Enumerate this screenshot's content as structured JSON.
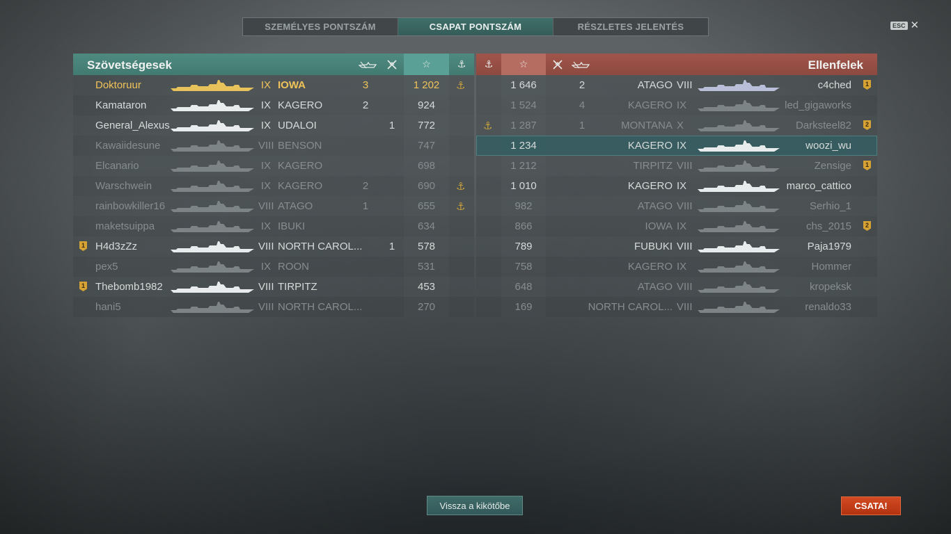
{
  "tabs": [
    {
      "label": "SZEMÉLYES PONTSZÁM",
      "active": false
    },
    {
      "label": "CSAPAT PONTSZÁM",
      "active": true
    },
    {
      "label": "RÉSZLETES JELENTÉS",
      "active": false
    }
  ],
  "esc": {
    "key": "ESC",
    "close": "✕"
  },
  "allies": {
    "title": "Szövetségesek",
    "header_icons": [
      "ship-kill-icon",
      "plane-kill-icon",
      "star-icon",
      "anchor-icon"
    ],
    "rows": [
      {
        "name": "Doktoruur",
        "tier": "IX",
        "ship": "IOWA",
        "kills": "3",
        "planes": "",
        "score": "1 202",
        "anchor": "⚓",
        "badge": "",
        "state": "me"
      },
      {
        "name": "Kamataron",
        "tier": "IX",
        "ship": "KAGERO",
        "kills": "2",
        "planes": "",
        "score": "924",
        "anchor": "",
        "badge": "",
        "state": "alive"
      },
      {
        "name": "General_Alexus",
        "tier": "IX",
        "ship": "UDALOI",
        "kills": "",
        "planes": "1",
        "score": "772",
        "anchor": "",
        "badge": "",
        "state": "alive"
      },
      {
        "name": "Kawaiidesune",
        "tier": "VIII",
        "ship": "BENSON",
        "kills": "",
        "planes": "",
        "score": "747",
        "anchor": "",
        "badge": "",
        "state": "dead"
      },
      {
        "name": "Elcanario",
        "tier": "IX",
        "ship": "KAGERO",
        "kills": "",
        "planes": "",
        "score": "698",
        "anchor": "",
        "badge": "",
        "state": "dead"
      },
      {
        "name": "Warschwein",
        "tier": "IX",
        "ship": "KAGERO",
        "kills": "2",
        "planes": "",
        "score": "690",
        "anchor": "⚓",
        "badge": "",
        "state": "dead"
      },
      {
        "name": "rainbowkiller16",
        "tier": "VIII",
        "ship": "ATAGO",
        "kills": "1",
        "planes": "",
        "score": "655",
        "anchor": "⚓",
        "badge": "",
        "state": "dead"
      },
      {
        "name": "maketsuippa",
        "tier": "IX",
        "ship": "IBUKI",
        "kills": "",
        "planes": "",
        "score": "634",
        "anchor": "",
        "badge": "",
        "state": "dead"
      },
      {
        "name": "H4d3zZz",
        "tier": "VIII",
        "ship": "NORTH CAROL...",
        "kills": "",
        "planes": "1",
        "score": "578",
        "anchor": "",
        "badge": "1",
        "state": "alive"
      },
      {
        "name": "pex5",
        "tier": "IX",
        "ship": "ROON",
        "kills": "",
        "planes": "",
        "score": "531",
        "anchor": "",
        "badge": "",
        "state": "dead"
      },
      {
        "name": "Thebomb1982",
        "tier": "VIII",
        "ship": "TIRPITZ",
        "kills": "",
        "planes": "",
        "score": "453",
        "anchor": "",
        "badge": "1",
        "state": "alive"
      },
      {
        "name": "hani5",
        "tier": "VIII",
        "ship": "NORTH CAROL...",
        "kills": "",
        "planes": "",
        "score": "270",
        "anchor": "",
        "badge": "",
        "state": "dead"
      }
    ]
  },
  "enemies": {
    "title": "Ellenfelek",
    "header_icons": [
      "anchor-icon",
      "star-icon",
      "plane-kill-icon",
      "ship-kill-icon"
    ],
    "rows": [
      {
        "name": "c4ched",
        "tier": "VIII",
        "ship": "ATAGO",
        "kills": "2",
        "planes": "",
        "score": "1 646",
        "anchor": "",
        "badge": "1",
        "state": "alive"
      },
      {
        "name": "led_gigaworks",
        "tier": "IX",
        "ship": "KAGERO",
        "kills": "4",
        "planes": "",
        "score": "1 524",
        "anchor": "",
        "badge": "",
        "state": "dead"
      },
      {
        "name": "Darksteel82",
        "tier": "X",
        "ship": "MONTANA",
        "kills": "1",
        "planes": "",
        "score": "1 287",
        "anchor": "⚓",
        "badge": "2",
        "state": "dead"
      },
      {
        "name": "woozi_wu",
        "tier": "IX",
        "ship": "KAGERO",
        "kills": "",
        "planes": "",
        "score": "1 234",
        "anchor": "",
        "badge": "",
        "state": "highlight"
      },
      {
        "name": "Zensige",
        "tier": "VIII",
        "ship": "TIRPITZ",
        "kills": "",
        "planes": "",
        "score": "1 212",
        "anchor": "",
        "badge": "1",
        "state": "dead"
      },
      {
        "name": "marco_cattico",
        "tier": "IX",
        "ship": "KAGERO",
        "kills": "",
        "planes": "",
        "score": "1 010",
        "anchor": "",
        "badge": "",
        "state": "alive"
      },
      {
        "name": "Serhio_1",
        "tier": "VIII",
        "ship": "ATAGO",
        "kills": "",
        "planes": "",
        "score": "982",
        "anchor": "",
        "badge": "",
        "state": "dead"
      },
      {
        "name": "chs_2015",
        "tier": "IX",
        "ship": "IOWA",
        "kills": "",
        "planes": "",
        "score": "866",
        "anchor": "",
        "badge": "2",
        "state": "dead"
      },
      {
        "name": "Paja1979",
        "tier": "VIII",
        "ship": "FUBUKI",
        "kills": "",
        "planes": "",
        "score": "789",
        "anchor": "",
        "badge": "",
        "state": "alive"
      },
      {
        "name": "Hommer",
        "tier": "IX",
        "ship": "KAGERO",
        "kills": "",
        "planes": "",
        "score": "758",
        "anchor": "",
        "badge": "",
        "state": "dead"
      },
      {
        "name": "kropeksk",
        "tier": "VIII",
        "ship": "ATAGO",
        "kills": "",
        "planes": "",
        "score": "648",
        "anchor": "",
        "badge": "",
        "state": "dead"
      },
      {
        "name": "renaldo33",
        "tier": "VIII",
        "ship": "NORTH CAROL...",
        "kills": "",
        "planes": "",
        "score": "169",
        "anchor": "",
        "badge": "",
        "state": "dead"
      }
    ]
  },
  "buttons": {
    "back": "Vissza a kikötőbe",
    "battle": "CSATA!"
  },
  "colors": {
    "ally": "#4f8a80",
    "enemy": "#a0554a",
    "player": "#f0c25a",
    "battle": "#c93d17"
  }
}
